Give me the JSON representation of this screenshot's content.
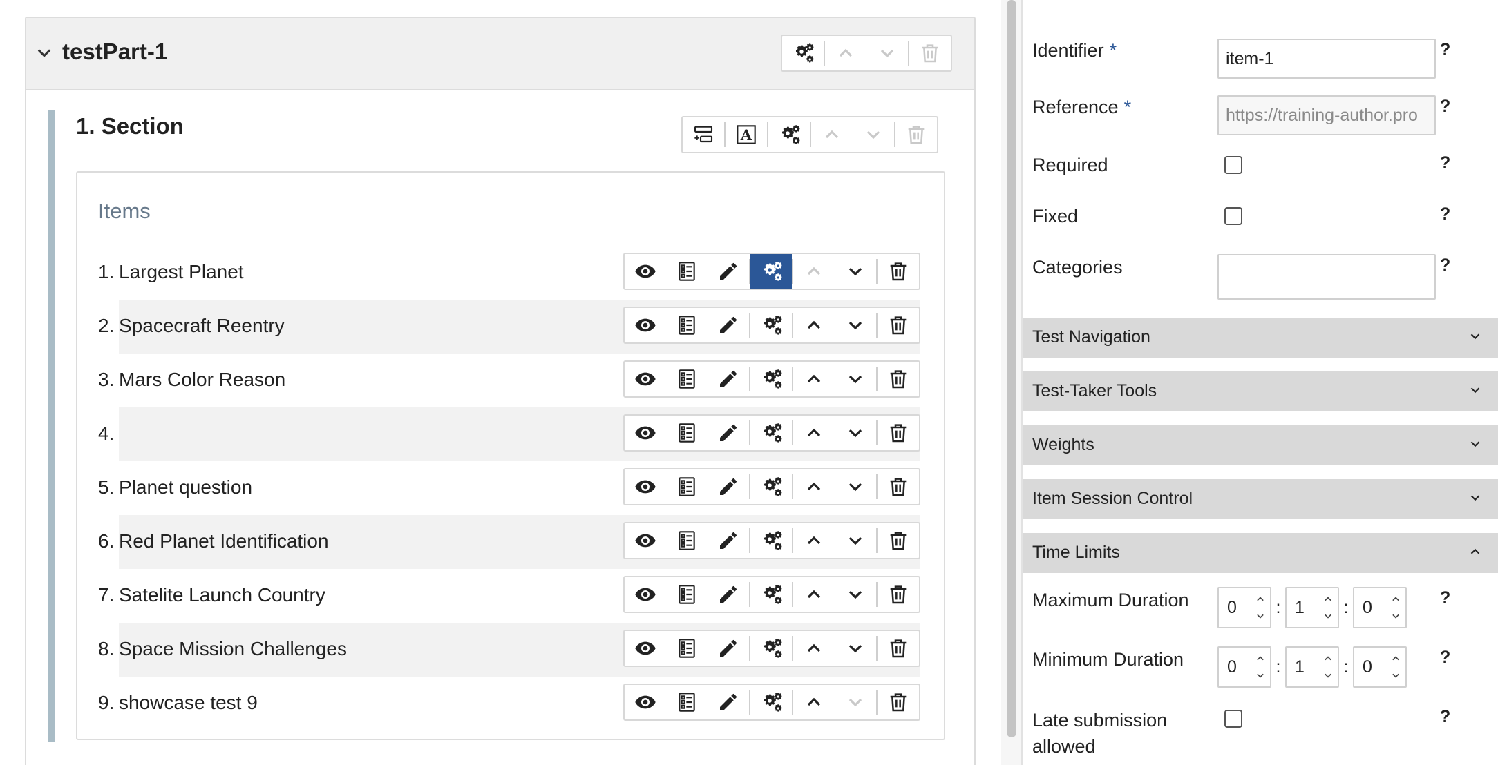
{
  "test_part": {
    "title": "testPart-1"
  },
  "section": {
    "title": "1. Section"
  },
  "items_box": {
    "label": "Items"
  },
  "items": [
    {
      "number": "1.",
      "label": "Largest Planet",
      "up_disabled": true,
      "down_disabled": false,
      "active_settings": true
    },
    {
      "number": "2.",
      "label": "Spacecraft Reentry",
      "up_disabled": false,
      "down_disabled": false,
      "active_settings": false
    },
    {
      "number": "3.",
      "label": "Mars Color Reason",
      "up_disabled": false,
      "down_disabled": false,
      "active_settings": false
    },
    {
      "number": "4.",
      "label": "",
      "up_disabled": false,
      "down_disabled": false,
      "active_settings": false
    },
    {
      "number": "5.",
      "label": "Planet question",
      "up_disabled": false,
      "down_disabled": false,
      "active_settings": false
    },
    {
      "number": "6.",
      "label": "Red Planet Identification",
      "up_disabled": false,
      "down_disabled": false,
      "active_settings": false
    },
    {
      "number": "7.",
      "label": "Satelite Launch Country",
      "up_disabled": false,
      "down_disabled": false,
      "active_settings": false
    },
    {
      "number": "8.",
      "label": "Space Mission Challenges",
      "up_disabled": false,
      "down_disabled": false,
      "active_settings": false
    },
    {
      "number": "9.",
      "label": "showcase test 9",
      "up_disabled": false,
      "down_disabled": true,
      "active_settings": false
    }
  ],
  "properties": {
    "identifier": {
      "label": "Identifier",
      "required_mark": "*",
      "value": "item-1"
    },
    "reference": {
      "label": "Reference",
      "required_mark": "*",
      "value": "https://training-author.pro"
    },
    "required": {
      "label": "Required"
    },
    "fixed": {
      "label": "Fixed"
    },
    "categories": {
      "label": "Categories",
      "value": ""
    },
    "help_mark": "?"
  },
  "accordions": {
    "test_navigation": "Test Navigation",
    "test_taker_tools": "Test-Taker Tools",
    "weights": "Weights",
    "item_session_control": "Item Session Control",
    "time_limits": "Time Limits"
  },
  "time_limits": {
    "maximum_duration": {
      "label": "Maximum Duration",
      "hours": "0",
      "minutes": "1",
      "seconds": "0"
    },
    "minimum_duration": {
      "label": "Minimum Duration",
      "hours": "0",
      "minutes": "1",
      "seconds": "0"
    },
    "late_submission": {
      "label_line1": "Late submission",
      "label_line2": "allowed"
    },
    "separator": ":"
  },
  "colors": {
    "accent": "#2b5797",
    "section_bar": "#a9bcc6",
    "accordion_bg": "#d9d9d9"
  },
  "icons": {
    "item_toolbar": [
      "eye-icon",
      "checklist-icon",
      "pencil-icon",
      "gears-icon",
      "chevron-up-icon",
      "chevron-down-icon",
      "trash-icon"
    ],
    "part_toolbar": [
      "gears-icon",
      "chevron-up-icon",
      "chevron-down-icon",
      "trash-icon"
    ],
    "section_toolbar": [
      "add-item-icon",
      "rubric-block-icon",
      "gears-icon",
      "chevron-up-icon",
      "chevron-down-icon",
      "trash-icon"
    ]
  }
}
